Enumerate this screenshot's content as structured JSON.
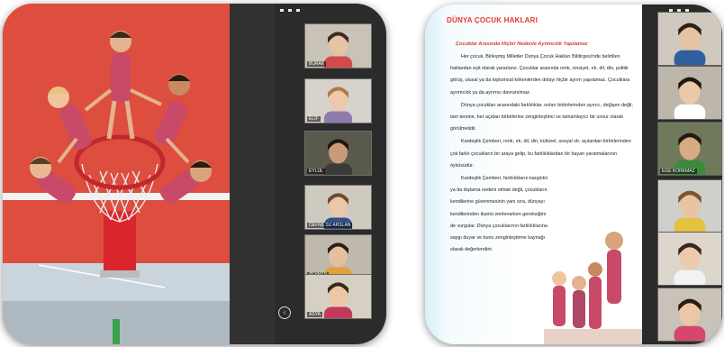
{
  "left": {
    "participants": [
      {
        "name": "BURAK",
        "bg": "#c9c2b6",
        "skin": "#e7c3a3",
        "hair": "#3b2a1f",
        "shirt": "#d24a4a"
      },
      {
        "name": "ELİF",
        "bg": "#d7d2cb",
        "skin": "#edc9ab",
        "hair": "#b07a47",
        "shirt": "#8f7bb0"
      },
      {
        "name": "EYLÜL",
        "bg": "#5a5a4c",
        "skin": "#c99b7c",
        "hair": "#1e1612",
        "shirt": "#3b3b3b"
      },
      {
        "name": "DEFNE SU ARSLAN",
        "bg": "#cfcac0",
        "skin": "#e9c7a8",
        "hair": "#6b4a2e",
        "shirt": "#2f4f8a"
      },
      {
        "name": "ZEYNEP",
        "bg": "#bfb8ad",
        "skin": "#e6c09e",
        "hair": "#2a1e16",
        "shirt": "#e0a23a"
      },
      {
        "name": "ASYA",
        "bg": "#d5cfc4",
        "skin": "#ebc7a7",
        "hair": "#3a2718",
        "shirt": "#c23a5a"
      }
    ]
  },
  "right": {
    "title": "DÜNYA ÇOCUK HAKLARI",
    "subtitle": "Çocuklar Arasında Hiçbir Nedenle Ayrımcılık Yapılamaz",
    "paragraphs": [
      "Her çocuk, Birleşmiş Milletler Dünya Çocuk Hakları Bildirgesi'nde belirtilen haklardan eşit olarak yararlanır. Çocuklar arasında renk, cinsiyet, ırk, dil, din, politik görüş, ulusal ya da toplumsal kökenlerden dolayı hiçbir ayrım yapılamaz. Çocuklara ayrımcılık ya da ayrımcı davranılmaz.",
      "Dünya çocukları arasındaki farklılıklar, onları birbirlerinden ayırıcı, değişen değil; tam tersine, her açıdan birbirlerine zenginleştirici ve tamamlayıcı bir unsur olarak görülmelidir.",
      "Kardeşlik Çemberi, renk, ırk, dil, din, kültürel, sosyal vb. açılardan birbirlerinden çok farklı çocukların bir araya gelip, bu farklılıklardan bir bayan yaratmalarının öyküsüdür.",
      "Kardeşlik Çemberi, farklılıkların kargılıklı ya da dışlama nedeni olmak değil, çocukların kendilerine güvenmesinin yanı sıra, dünyayı kendilerinden ikamü zenlenarken gereksiğini de vurgular. Dünya çocuklarının farklılıklarına saygı duyar ve bunu zenginleştirme kaynağı olarak değerlendirir."
    ],
    "participants": [
      {
        "name": "",
        "bg": "#cfc9bf",
        "skin": "#e6c3a3",
        "hair": "#2d2119",
        "shirt": "#2f5fa0"
      },
      {
        "name": "",
        "bg": "#bdb6ab",
        "skin": "#eac8a8",
        "hair": "#1f1712",
        "shirt": "#ffffff"
      },
      {
        "name": "EGE KORKMAZ",
        "bg": "#6f7a5a",
        "skin": "#d8ab86",
        "hair": "#24190f",
        "shirt": "#3a8a3a"
      },
      {
        "name": "",
        "bg": "#cfd0cc",
        "skin": "#e8c4a2",
        "hair": "#7a5632",
        "shirt": "#e3c240"
      },
      {
        "name": "",
        "bg": "#dcd6cc",
        "skin": "#eccaad",
        "hair": "#3b281b",
        "shirt": "#f2f2f2"
      },
      {
        "name": "",
        "bg": "#c8c2b8",
        "skin": "#ecc6a6",
        "hair": "#2a1c13",
        "shirt": "#d6486b"
      }
    ]
  }
}
